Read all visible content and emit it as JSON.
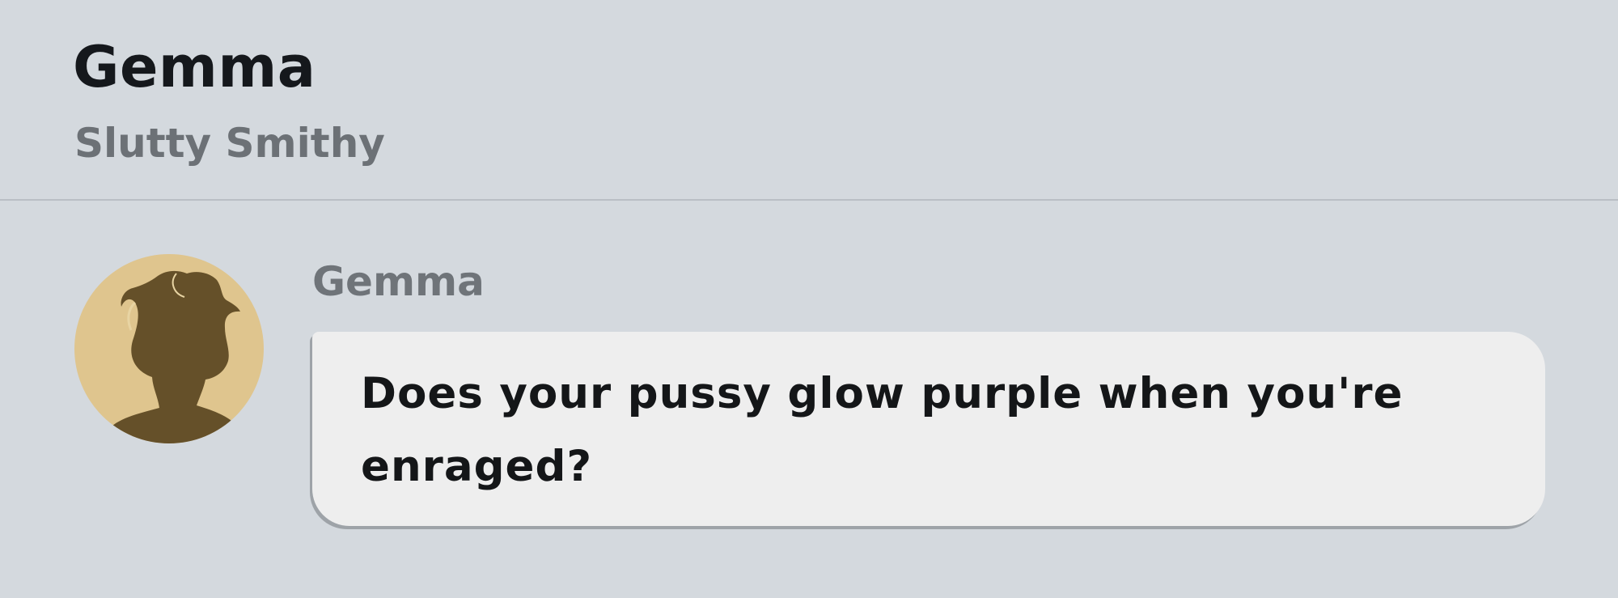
{
  "header": {
    "title": "Gemma",
    "subtitle": "Slutty Smithy"
  },
  "message": {
    "avatar_icon": "character-silhouette-avatar",
    "sender": "Gemma",
    "text": "Does your pussy glow purple when you're enraged?"
  },
  "colors": {
    "background": "#d4d9de",
    "avatar_background": "#dfc58e",
    "avatar_silhouette": "#655029",
    "bubble": "#eeeeee"
  }
}
